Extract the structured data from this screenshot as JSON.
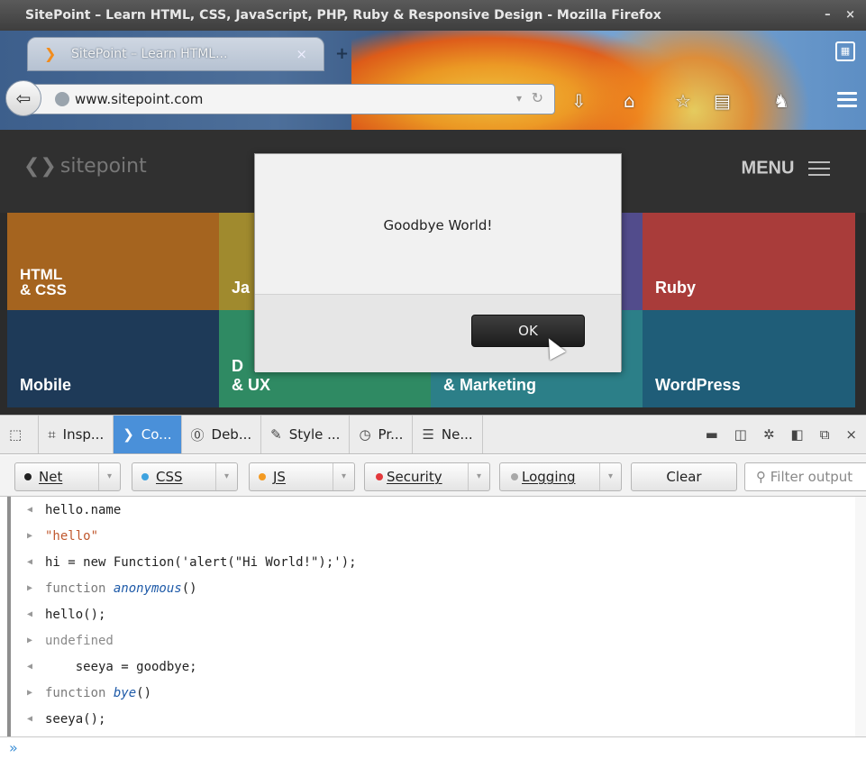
{
  "window": {
    "title": "SitePoint – Learn HTML, CSS, JavaScript, PHP, Ruby & Responsive Design - Mozilla Firefox",
    "controls": "– ×"
  },
  "tab": {
    "favicon": "sitepoint-chevron-icon",
    "label": "SitePoint – Learn HTML...",
    "close": "×",
    "new_tab": "+"
  },
  "navbar": {
    "url": "www.sitepoint.com",
    "icons": [
      "back-icon",
      "globe-icon",
      "dropdown-icon",
      "reload-icon",
      "download-icon",
      "home-icon",
      "bookmark-star-icon",
      "reading-list-icon",
      "ghostery-icon",
      "menu-icon"
    ]
  },
  "page": {
    "logo_text": "sitepoint",
    "menu_label": "MENU",
    "tiles": [
      {
        "label": "HTML\n& CSS",
        "color": "#a5641f"
      },
      {
        "label": "Ja",
        "color": "#a08a2e"
      },
      {
        "label": "",
        "color": "#524c8c"
      },
      {
        "label": "Ruby",
        "color": "#a93c3a"
      },
      {
        "label": "Mobile",
        "color": "#1e3a58"
      },
      {
        "label": "D\n& UX",
        "color": "#2f8a63"
      },
      {
        "label": "& Marketing",
        "color": "#2c7f88"
      },
      {
        "label": "WordPress",
        "color": "#1f5d78"
      }
    ]
  },
  "dialog": {
    "message": "Goodbye World!",
    "ok_label": "OK"
  },
  "devtools": {
    "tools": [
      {
        "label": "",
        "icon": "pick-element-icon",
        "active": false
      },
      {
        "label": "Insp...",
        "icon": "inspector-icon",
        "active": false
      },
      {
        "label": "Co...",
        "icon": "console-icon",
        "active": true
      },
      {
        "label": "Deb...",
        "icon": "debugger-icon",
        "active": false
      },
      {
        "label": "Style ...",
        "icon": "style-editor-icon",
        "active": false
      },
      {
        "label": "Pr...",
        "icon": "profiler-icon",
        "active": false
      },
      {
        "label": "Ne...",
        "icon": "network-icon",
        "active": false
      }
    ],
    "filters": [
      {
        "label": "Net",
        "dot_color": "#222222"
      },
      {
        "label": "CSS",
        "dot_color": "#3ea2df"
      },
      {
        "label": "JS",
        "dot_color": "#f39a22"
      },
      {
        "label": "Security",
        "dot_color": "#e3393c"
      },
      {
        "label": "Logging",
        "dot_color": "#a8a8a8"
      }
    ],
    "clear_label": "Clear",
    "filter_placeholder": "Filter output",
    "console_lines": [
      {
        "dir": "in",
        "kind": "input",
        "text": "hello.name"
      },
      {
        "dir": "out",
        "kind": "string",
        "text": "\"hello\""
      },
      {
        "dir": "in",
        "kind": "input",
        "text": "hi = new Function('alert(\"Hi World!\");');"
      },
      {
        "dir": "out",
        "kind": "function",
        "prefix": "function ",
        "name": "anonymous",
        "suffix": "()"
      },
      {
        "dir": "in",
        "kind": "input",
        "text": "hello();"
      },
      {
        "dir": "out",
        "kind": "undefined",
        "text": "undefined"
      },
      {
        "dir": "in",
        "kind": "input",
        "text": "    seeya = goodbye;"
      },
      {
        "dir": "out",
        "kind": "function",
        "prefix": "function ",
        "name": "bye",
        "suffix": "()"
      },
      {
        "dir": "in",
        "kind": "input",
        "text": "seeya();"
      }
    ],
    "prompt": "»"
  }
}
